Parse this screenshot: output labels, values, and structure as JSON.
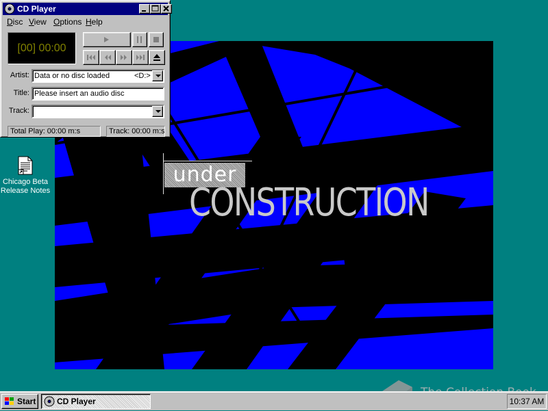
{
  "desktop": {
    "background_color": "#008080",
    "wallpaper": {
      "under_text": "under",
      "construction_text": "CONSTRUCTION",
      "colors": {
        "primary": "#0000ff",
        "secondary": "#000000",
        "text": "#c9c9c9"
      }
    },
    "icons": [
      {
        "label_line1": "Chicago Beta",
        "label_line2": "Release Notes",
        "icon": "document-icon"
      }
    ]
  },
  "cd_player": {
    "title": "CD Player",
    "title_buttons": [
      "minimize",
      "maximize",
      "close"
    ],
    "menu": [
      {
        "label": "Disc",
        "accel": "D",
        "rest": "isc"
      },
      {
        "label": "View",
        "accel": "V",
        "rest": "iew"
      },
      {
        "label": "Options",
        "accel": "O",
        "rest": "ptions"
      },
      {
        "label": "Help",
        "accel": "H",
        "rest": "elp"
      }
    ],
    "display": "[00] 00:00",
    "display_color": "#808000",
    "transport_buttons": [
      "play",
      "pause",
      "stop",
      "previous-track",
      "skip-backward",
      "skip-forward",
      "next-track",
      "eject"
    ],
    "artist": {
      "label": "Artist:",
      "value": "Data or no disc loaded",
      "drive": "<D:>"
    },
    "title_field": {
      "label": "Title:",
      "value": "Please insert an audio disc"
    },
    "track": {
      "label": "Track:",
      "value": ""
    },
    "status": {
      "total_play": "Total Play: 00:00 m:s",
      "track": "Track: 00:00 m:s"
    }
  },
  "taskbar": {
    "start_label": "Start",
    "task_label": "CD Player",
    "clock": "10:37 AM"
  },
  "watermark": {
    "text": "The Collection Book"
  }
}
